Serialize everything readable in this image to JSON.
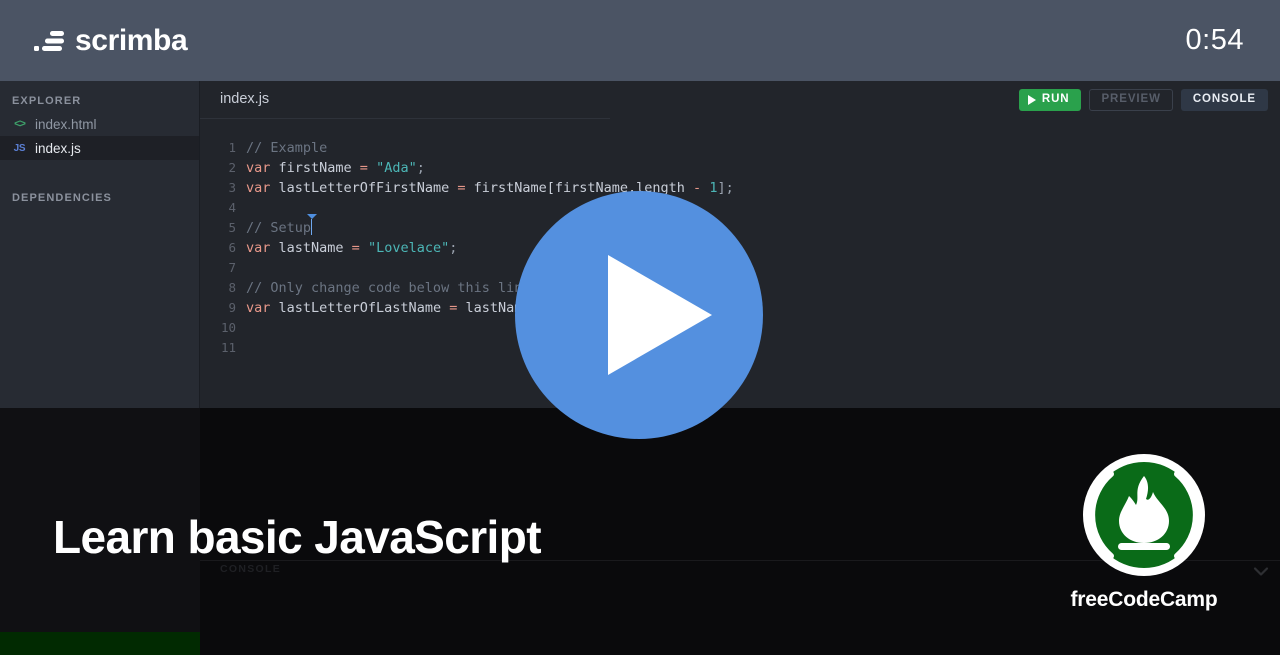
{
  "header": {
    "brand_name": "scrimba",
    "brand_icon": "scrimba-logo-icon",
    "timer": "0:54"
  },
  "sidebar": {
    "explorer_heading": "EXPLORER",
    "dependencies_heading": "DEPENDENCIES",
    "files": [
      {
        "name": "index.html",
        "icon": "html-file-icon",
        "icon_glyph": "<>",
        "active": false
      },
      {
        "name": "index.js",
        "icon": "js-file-icon",
        "icon_glyph": "JS",
        "active": true
      }
    ]
  },
  "editor": {
    "tab_label": "index.js",
    "buttons": {
      "run": "RUN",
      "preview": "PREVIEW",
      "console": "CONSOLE"
    },
    "lines": [
      {
        "n": "1",
        "tokens": [
          {
            "t": "// Example",
            "c": "tok-com"
          }
        ]
      },
      {
        "n": "2",
        "tokens": [
          {
            "t": "var",
            "c": "tok-kw"
          },
          {
            "t": " firstName ",
            "c": "tok-var"
          },
          {
            "t": "=",
            "c": "tok-op"
          },
          {
            "t": " ",
            "c": "tok-var"
          },
          {
            "t": "\"Ada\"",
            "c": "tok-str"
          },
          {
            "t": ";",
            "c": "tok-pun"
          }
        ]
      },
      {
        "n": "3",
        "tokens": [
          {
            "t": "var",
            "c": "tok-kw"
          },
          {
            "t": " lastLetterOfFirstName ",
            "c": "tok-var"
          },
          {
            "t": "=",
            "c": "tok-op"
          },
          {
            "t": " firstName[firstName.length ",
            "c": "tok-var"
          },
          {
            "t": "-",
            "c": "tok-op"
          },
          {
            "t": " ",
            "c": "tok-var"
          },
          {
            "t": "1",
            "c": "tok-num"
          },
          {
            "t": "];",
            "c": "tok-pun"
          }
        ]
      },
      {
        "n": "4",
        "tokens": []
      },
      {
        "n": "5",
        "tokens": [
          {
            "t": "// Setup",
            "c": "tok-com"
          }
        ],
        "caret": true
      },
      {
        "n": "6",
        "tokens": [
          {
            "t": "var",
            "c": "tok-kw"
          },
          {
            "t": " lastName ",
            "c": "tok-var"
          },
          {
            "t": "=",
            "c": "tok-op"
          },
          {
            "t": " ",
            "c": "tok-var"
          },
          {
            "t": "\"Lovelace\"",
            "c": "tok-str"
          },
          {
            "t": ";",
            "c": "tok-pun"
          }
        ]
      },
      {
        "n": "7",
        "tokens": []
      },
      {
        "n": "8",
        "tokens": [
          {
            "t": "// Only change code below this line.",
            "c": "tok-com"
          }
        ]
      },
      {
        "n": "9",
        "tokens": [
          {
            "t": "var",
            "c": "tok-kw"
          },
          {
            "t": " lastLetterOfLastName ",
            "c": "tok-var"
          },
          {
            "t": "=",
            "c": "tok-op"
          },
          {
            "t": " lastName",
            "c": "tok-var"
          },
          {
            "t": ";",
            "c": "tok-pun"
          }
        ]
      },
      {
        "n": "10",
        "tokens": []
      },
      {
        "n": "11",
        "tokens": []
      }
    ]
  },
  "overlay": {
    "play_button_icon": "play-icon",
    "play_color": "#5490df"
  },
  "lower": {
    "console_label": "CONSOLE",
    "collapse_icon": "chevron-down-icon",
    "course_title": "Learn basic JavaScript",
    "brand": {
      "name": "freeCodeCamp",
      "logo_icon": "freecodecamp-flame-logo",
      "logo_color": "#0a6b18"
    }
  },
  "colors": {
    "topbar_bg": "#4b5464",
    "sidebar_bg": "#272b33",
    "editor_bg": "#22252b",
    "run_green": "#2aa14c",
    "play_blue": "#5490df",
    "fcc_green": "#0a6b18",
    "bottom_bar_green": "#012a01"
  }
}
